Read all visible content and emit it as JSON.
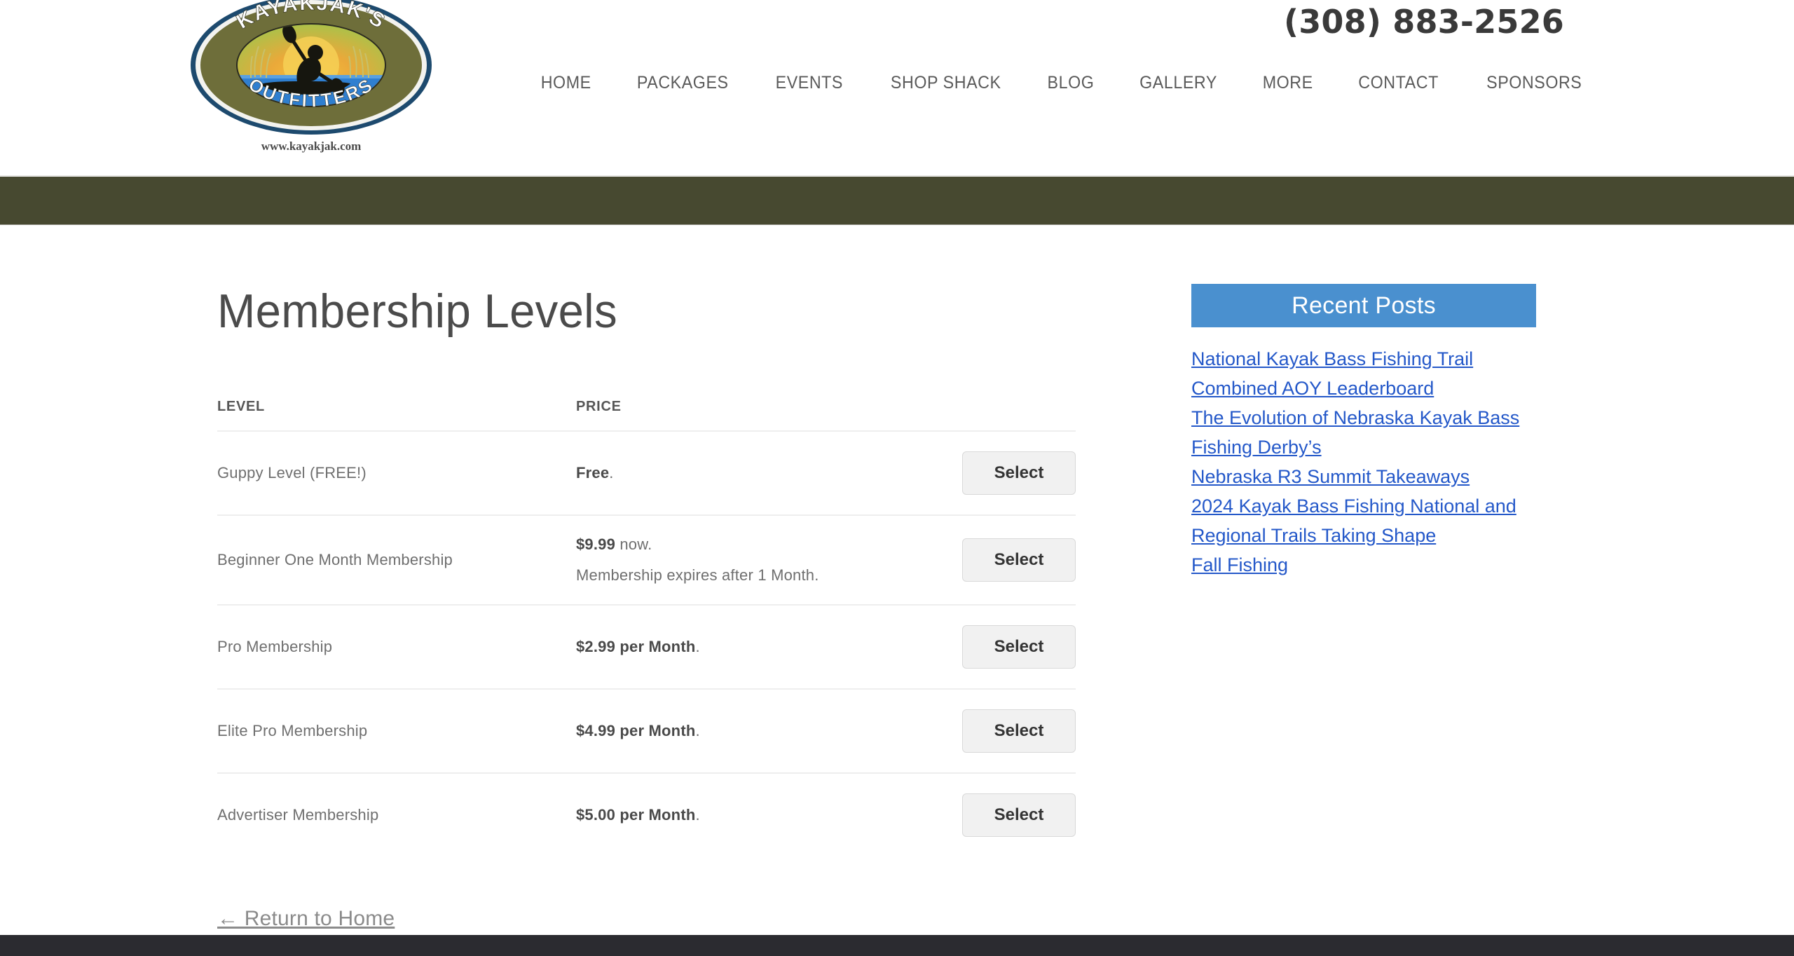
{
  "header": {
    "phone": "(308) 883-2526",
    "logo": {
      "top_text": "KAYAKJAK'S",
      "bottom_text": "OUTFITTERS",
      "url_text": "www.kayakjak.com"
    },
    "nav": [
      {
        "label": "HOME"
      },
      {
        "label": "PACKAGES"
      },
      {
        "label": "EVENTS"
      },
      {
        "label": "SHOP SHACK"
      },
      {
        "label": "BLOG"
      },
      {
        "label": "GALLERY"
      },
      {
        "label": "MORE"
      },
      {
        "label": "CONTACT"
      },
      {
        "label": "SPONSORS"
      }
    ]
  },
  "main": {
    "title": "Membership Levels",
    "table": {
      "headers": {
        "level": "LEVEL",
        "price": "PRICE"
      },
      "rows": [
        {
          "level": "Guppy Level (FREE!)",
          "price_bold": "Free",
          "price_rest": ".",
          "price_note": "",
          "action_label": "Select"
        },
        {
          "level": "Beginner One Month Membership",
          "price_bold": "$9.99",
          "price_rest": " now.",
          "price_note": "Membership expires after 1 Month.",
          "action_label": "Select"
        },
        {
          "level": "Pro Membership",
          "price_bold": "$2.99 per Month",
          "price_rest": ".",
          "price_note": "",
          "action_label": "Select"
        },
        {
          "level": "Elite Pro Membership",
          "price_bold": "$4.99 per Month",
          "price_rest": ".",
          "price_note": "",
          "action_label": "Select"
        },
        {
          "level": "Advertiser Membership",
          "price_bold": "$5.00 per Month",
          "price_rest": ".",
          "price_note": "",
          "action_label": "Select"
        }
      ]
    },
    "return_home": "← Return to Home"
  },
  "sidebar": {
    "widget_title": "Recent Posts",
    "posts": [
      {
        "title": "National Kayak Bass Fishing Trail Combined AOY Leaderboard"
      },
      {
        "title": "The Evolution of Nebraska Kayak Bass Fishing Derby’s"
      },
      {
        "title": "Nebraska R3 Summit Takeaways"
      },
      {
        "title": "2024 Kayak Bass Fishing National and Regional Trails Taking Shape"
      },
      {
        "title": "Fall Fishing"
      }
    ]
  },
  "colors": {
    "olive_band": "#474930",
    "widget_blue": "#4a90cf",
    "link_blue": "#2458c9",
    "footer_dark": "#2b2b30",
    "button_gray": "#f1f1f1"
  }
}
